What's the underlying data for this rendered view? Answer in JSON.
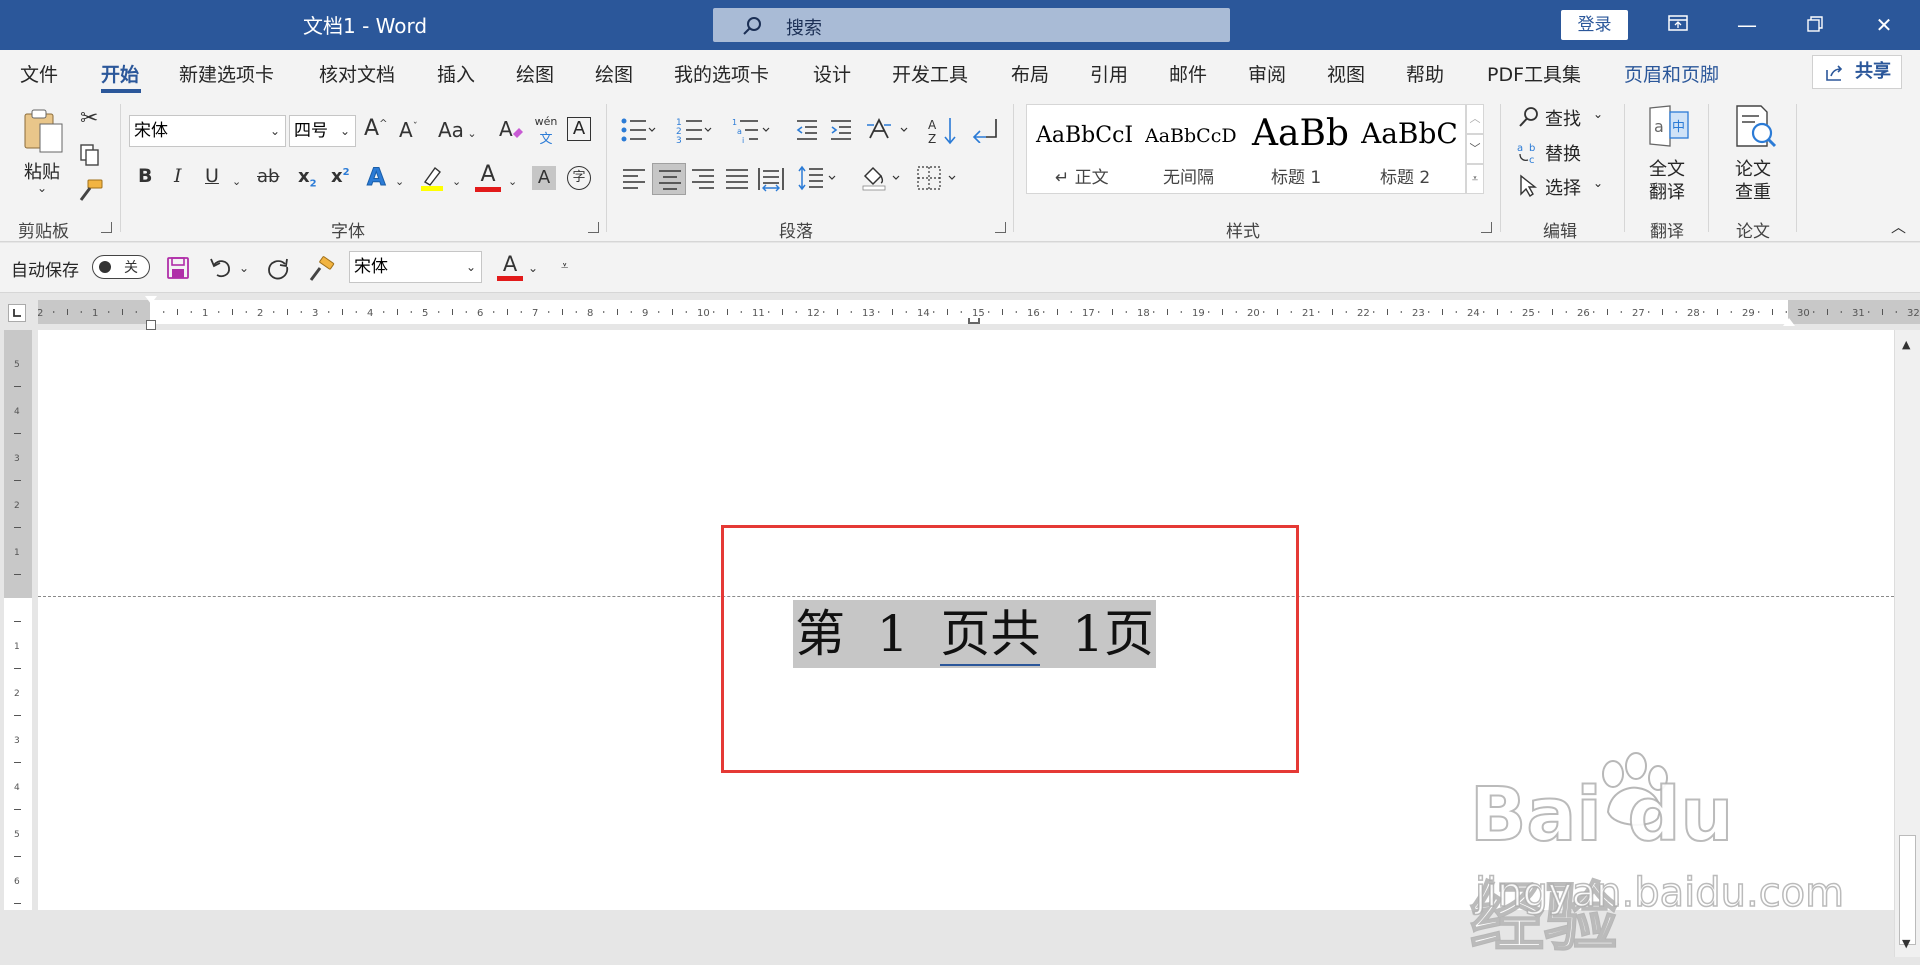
{
  "window": {
    "title": "文档1  -  Word",
    "search_placeholder": "搜索",
    "login": "登录"
  },
  "tabs": [
    "文件",
    "开始",
    "新建选项卡",
    "核对文档",
    "插入",
    "绘图",
    "绘图",
    "我的选项卡",
    "设计",
    "开发工具",
    "布局",
    "引用",
    "邮件",
    "审阅",
    "视图",
    "帮助",
    "PDF工具集",
    "页眉和页脚"
  ],
  "share": "共享",
  "clipboard": {
    "paste": "粘贴",
    "label": "剪贴板"
  },
  "font": {
    "name": "宋体",
    "size": "四号",
    "label": "字体",
    "case": "Aa",
    "phonetic_top": "wén",
    "phonetic_bottom": "文",
    "bold": "B",
    "italic": "I",
    "underline": "U",
    "strike": "ab",
    "sub": "x",
    "sup": "x",
    "fontcolor": "A",
    "shade": "A",
    "circle": "字"
  },
  "paragraph": {
    "label": "段落"
  },
  "styles": {
    "label": "样式",
    "items": [
      {
        "sample": "AaBbCcI",
        "name": "↵ 正文"
      },
      {
        "sample": "AaBbCcD",
        "name": "无间隔"
      },
      {
        "sample": "AaBb",
        "name": "标题 1"
      },
      {
        "sample": "AaBbC",
        "name": "标题 2"
      }
    ]
  },
  "editing": {
    "find": "查找",
    "replace": "替换",
    "select": "选择",
    "label": "编辑"
  },
  "translate": {
    "full": "全文",
    "full2": "翻译",
    "label": "翻译"
  },
  "paper": {
    "check": "论文",
    "check2": "查重",
    "label": "论文"
  },
  "qat": {
    "autosave": "自动保存",
    "autosave_state": "关",
    "font": "宋体"
  },
  "document": {
    "footer_part1": "第  1  ",
    "footer_part2": "页共",
    "footer_part3": "  1页"
  },
  "watermark": {
    "logo": "Bai du 经验",
    "url": "jingyan.baidu.com"
  },
  "colors": {
    "accent": "#2b579a",
    "highlight": "#c6c6c6",
    "redbox": "#e53935"
  }
}
